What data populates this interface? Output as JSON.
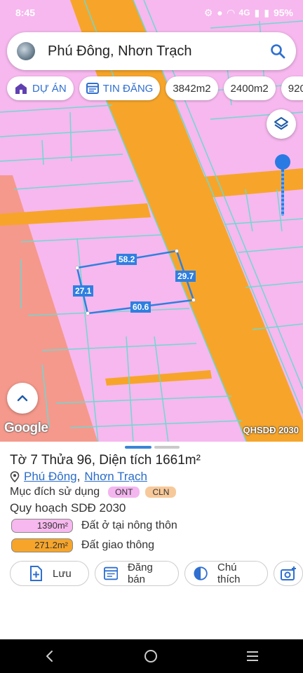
{
  "status": {
    "time": "8:45",
    "battery": "95%",
    "net": "4G"
  },
  "search": {
    "query": "Phú Đông, Nhơn Trạch"
  },
  "chips": [
    {
      "label": "DỰ ÁN"
    },
    {
      "label": "TIN ĐĂNG"
    },
    {
      "label": "3842m2"
    },
    {
      "label": "2400m2"
    },
    {
      "label": "920"
    }
  ],
  "map": {
    "edges": [
      "58.2",
      "29.7",
      "60.6",
      "27.1"
    ],
    "brand": "Google",
    "layer_label": "QHSDĐ 2030"
  },
  "sheet": {
    "title": "Tờ 7 Thửa 96, Diện tích 1661m²",
    "commune": "Phú Đông",
    "separator": ",",
    "district": "Nhơn Trạch",
    "purpose_label": "Mục đích sử dụng",
    "badges": [
      "ONT",
      "CLN"
    ],
    "plan_label": "Quy hoạch SDĐ 2030",
    "areas": [
      {
        "value": "1390m²",
        "label": "Đất ở tại nông thôn"
      },
      {
        "value": "271.2m²",
        "label": "Đất giao thông"
      }
    ],
    "actions": {
      "save": "Lưu",
      "sell": "Đăng bán",
      "legend": "Chú thích"
    }
  },
  "colors": {
    "residential": "#f6b8ee",
    "road": "#f6a52a",
    "accent": "#2a7ae4"
  }
}
